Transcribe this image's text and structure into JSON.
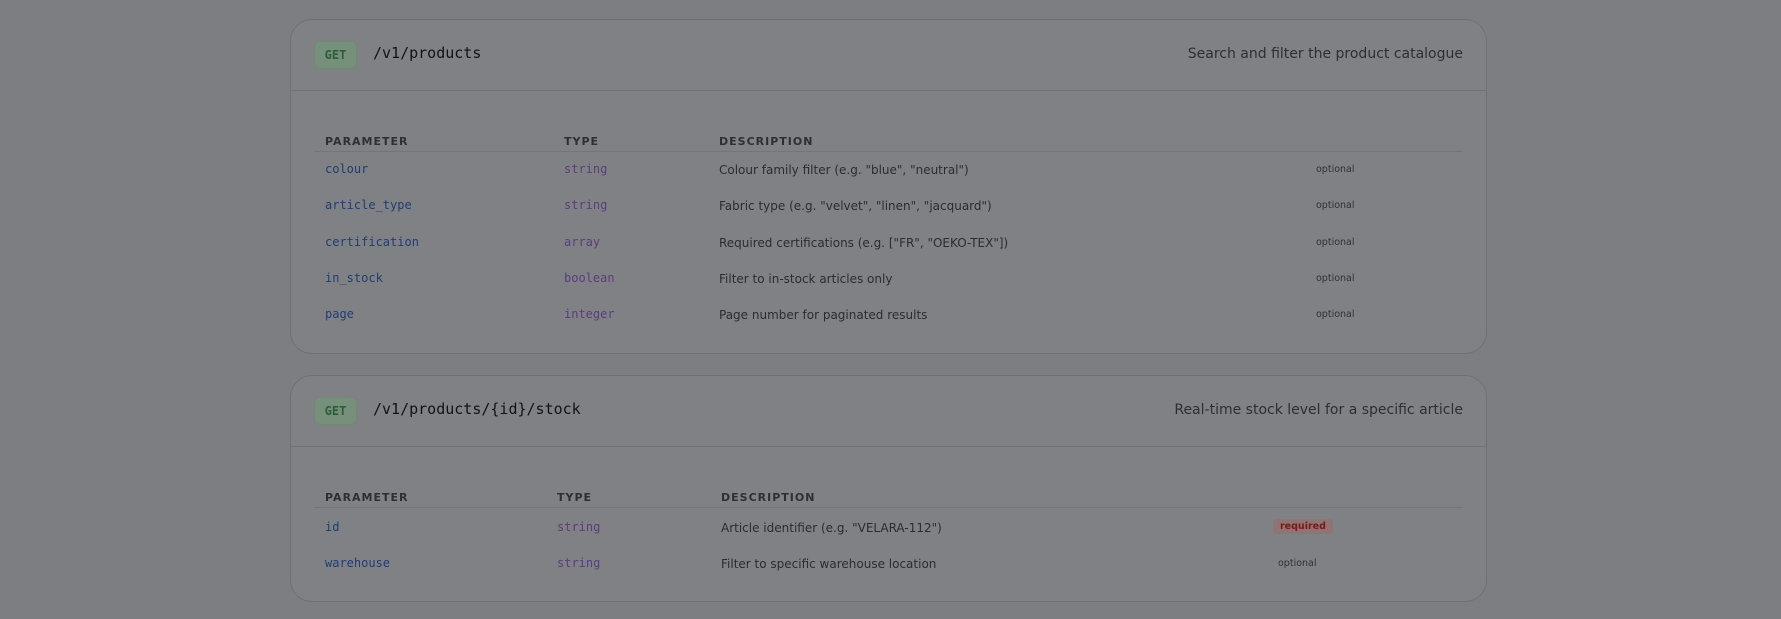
{
  "columns": {
    "parameter": "PARAMETER",
    "type": "TYPE",
    "description": "DESCRIPTION"
  },
  "endpoints": [
    {
      "method": "GET",
      "path": "/v1/products",
      "description": "Search and filter the product catalogue",
      "params": [
        {
          "name": "colour",
          "type": "string",
          "description": "Colour family filter (e.g. \"blue\", \"neutral\")",
          "flag": "optional"
        },
        {
          "name": "article_type",
          "type": "string",
          "description": "Fabric type (e.g. \"velvet\", \"linen\", \"jacquard\")",
          "flag": "optional"
        },
        {
          "name": "certification",
          "type": "array",
          "description": "Required certifications (e.g. [\"FR\", \"OEKO-TEX\"])",
          "flag": "optional"
        },
        {
          "name": "in_stock",
          "type": "boolean",
          "description": "Filter to in-stock articles only",
          "flag": "optional"
        },
        {
          "name": "page",
          "type": "integer",
          "description": "Page number for paginated results",
          "flag": "optional"
        }
      ]
    },
    {
      "method": "GET",
      "path": "/v1/products/{id}/stock",
      "description": "Real-time stock level for a specific article",
      "params": [
        {
          "name": "id",
          "type": "string",
          "description": "Article identifier (e.g. \"VELARA-112\")",
          "flag": "required"
        },
        {
          "name": "warehouse",
          "type": "string",
          "description": "Filter to specific warehouse location",
          "flag": "optional"
        }
      ]
    }
  ],
  "colors": {
    "overlay": "#7d7e82",
    "method_get": "#2c5f37",
    "param_name": "#1f3d72",
    "param_type": "#5a3d7e",
    "required": "#7a1919"
  }
}
